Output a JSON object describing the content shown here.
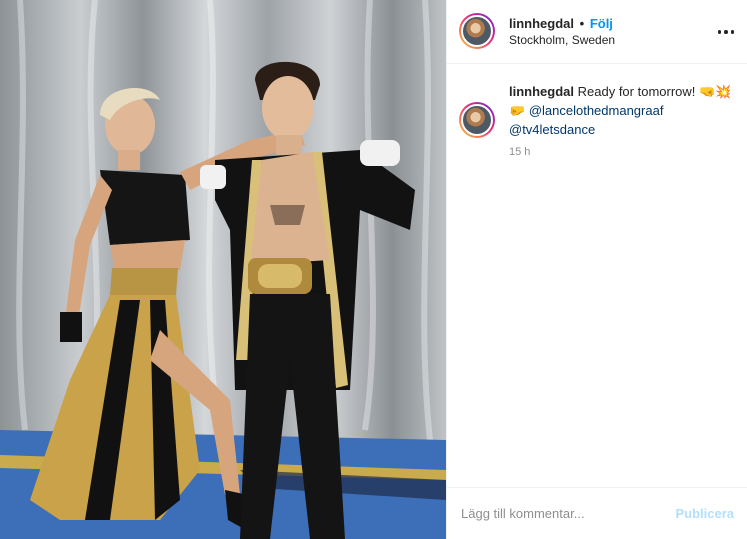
{
  "photo": {
    "alt_icon": "photo-image"
  },
  "header": {
    "username": "linnhegdal",
    "separator": "•",
    "follow_label": "Följ",
    "location": "Stockholm, Sweden",
    "more_icon": "more-horizontal-icon"
  },
  "caption": {
    "username": "linnhegdal",
    "text": "Ready for tomorrow! 🤜💥🤛",
    "mention1": "@lancelothedmangraaf",
    "mention2": "@tv4letsdance",
    "time": "15 h"
  },
  "comment_box": {
    "placeholder": "Lägg till kommentar...",
    "publish_label": "Publicera"
  },
  "colors": {
    "link": "#0095f6",
    "mention": "#00376b",
    "publish_disabled": "#b2dffc",
    "muted": "#8e8e8e"
  }
}
